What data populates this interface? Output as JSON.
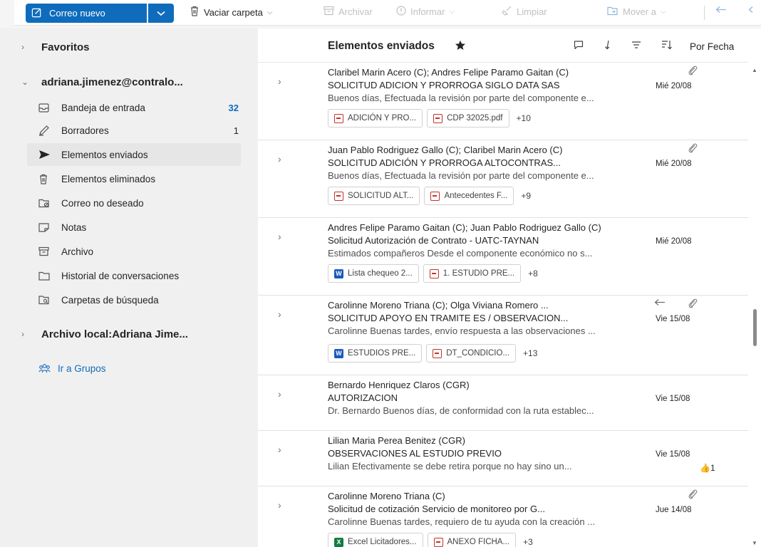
{
  "toolbar": {
    "new_mail_label": "Correo nuevo",
    "empty_folder_label": "Vaciar carpeta",
    "archive_label": "Archivar",
    "report_label": "Informar",
    "sweep_label": "Limpiar",
    "move_label": "Mover a"
  },
  "sidebar": {
    "favorites": "Favoritos",
    "account": "adriana.jimenez@contralo...",
    "folders": [
      {
        "label": "Bandeja de entrada",
        "count": "32"
      },
      {
        "label": "Borradores",
        "count": "1"
      },
      {
        "label": "Elementos enviados",
        "count": ""
      },
      {
        "label": "Elementos eliminados",
        "count": ""
      },
      {
        "label": "Correo no deseado",
        "count": ""
      },
      {
        "label": "Notas",
        "count": ""
      },
      {
        "label": "Archivo",
        "count": ""
      },
      {
        "label": "Historial de conversaciones",
        "count": ""
      },
      {
        "label": "Carpetas de búsqueda",
        "count": ""
      }
    ],
    "local_archive": "Archivo local:Adriana Jime...",
    "groups_link": "Ir a Grupos"
  },
  "list": {
    "title": "Elementos enviados",
    "sort_label": "Por Fecha",
    "messages": [
      {
        "from": "Claribel Marin Acero (C); Andres Felipe Paramo Gaitan (C)",
        "subject": "SOLICITUD ADICION Y PRORROGA SIGLO DATA SAS",
        "date": "Mié 20/08",
        "preview": "Buenos días, Efectuada la revisión por parte del componente e...",
        "attachments": [
          "ADICIÓN Y PRO...",
          "CDP 32025.pdf"
        ],
        "more": "+10"
      },
      {
        "from": "Juan Pablo Rodriguez Gallo (C); Claribel Marin Acero (C)",
        "subject": "SOLICITUD ADICIÓN Y PRORROGA ALTOCONTRAS...",
        "date": "Mié 20/08",
        "preview": "Buenos días, Efectuada la revisión por parte del componente e...",
        "attachments": [
          "SOLICITUD ALT...",
          "Antecedentes F..."
        ],
        "more": "+9"
      },
      {
        "from": "Andres Felipe Paramo Gaitan (C); Juan Pablo Rodriguez Gallo (C)",
        "subject": "Solicitud Autorización de Contrato - UATC-TAYNAN",
        "date": "Mié 20/08",
        "preview": "Estimados compañeros Desde el componente económico no s...",
        "attachments": [
          "Lista chequeo 2...",
          "1. ESTUDIO PRE..."
        ],
        "more": "+8"
      },
      {
        "from": "Carolinne Moreno Triana (C); Olga Viviana Romero ...",
        "subject": "SOLICITUD APOYO EN TRAMITE ES / OBSERVACION...",
        "date": "Vie 15/08",
        "preview": "Carolinne Buenas tardes, envío respuesta a las observaciones ...",
        "attachments": [
          "ESTUDIOS PRE...",
          "DT_CONDICIO..."
        ],
        "more": "+13"
      },
      {
        "from": "Bernardo Henriquez Claros (CGR)",
        "subject": "AUTORIZACION",
        "date": "Vie 15/08",
        "preview": "Dr. Bernardo Buenos días, de conformidad con la ruta establec..."
      },
      {
        "from": "Lilian Maria Perea Benitez (CGR)",
        "subject": "OBSERVACIONES AL ESTUDIO PREVIO",
        "date": "Vie 15/08",
        "preview": "Lilian Efectivamente se debe retira porque no hay sino un...",
        "reaction": "1"
      },
      {
        "from": "Carolinne Moreno Triana (C)",
        "subject": "Solicitud de cotización Servicio de monitoreo por G...",
        "date": "Jue 14/08",
        "preview": "Carolinne Buenas tardes, requiero de tu ayuda con la creación ...",
        "attachments": [
          "Excel Licitadores...",
          "ANEXO FICHA..."
        ],
        "more": "+3"
      }
    ]
  },
  "colors": {
    "accent": "#0f6cbd",
    "pdf": "#c4312b",
    "word": "#185abd",
    "excel": "#107c41"
  }
}
